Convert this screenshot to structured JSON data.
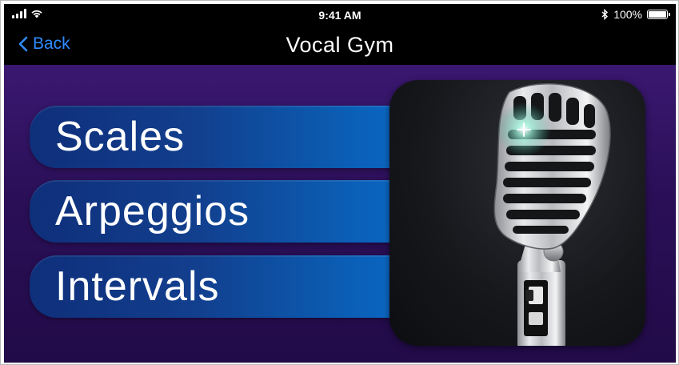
{
  "status_bar": {
    "time": "9:41 AM",
    "battery_text": "100%",
    "icons": [
      "signal-icon",
      "wifi-icon",
      "bluetooth-icon",
      "battery-icon"
    ]
  },
  "nav": {
    "back_label": "Back",
    "title": "Vocal Gym"
  },
  "menu": {
    "items": [
      {
        "label": "Scales"
      },
      {
        "label": "Arpeggios"
      },
      {
        "label": "Intervals"
      }
    ]
  },
  "colors": {
    "nav_background": "#000000",
    "back_link": "#2f8cff",
    "content_background": "#2a0f57",
    "button_gradient_start": "#0f2f7a",
    "button_gradient_end": "#0a6ed0"
  },
  "illustration": {
    "name": "microphone-icon"
  }
}
